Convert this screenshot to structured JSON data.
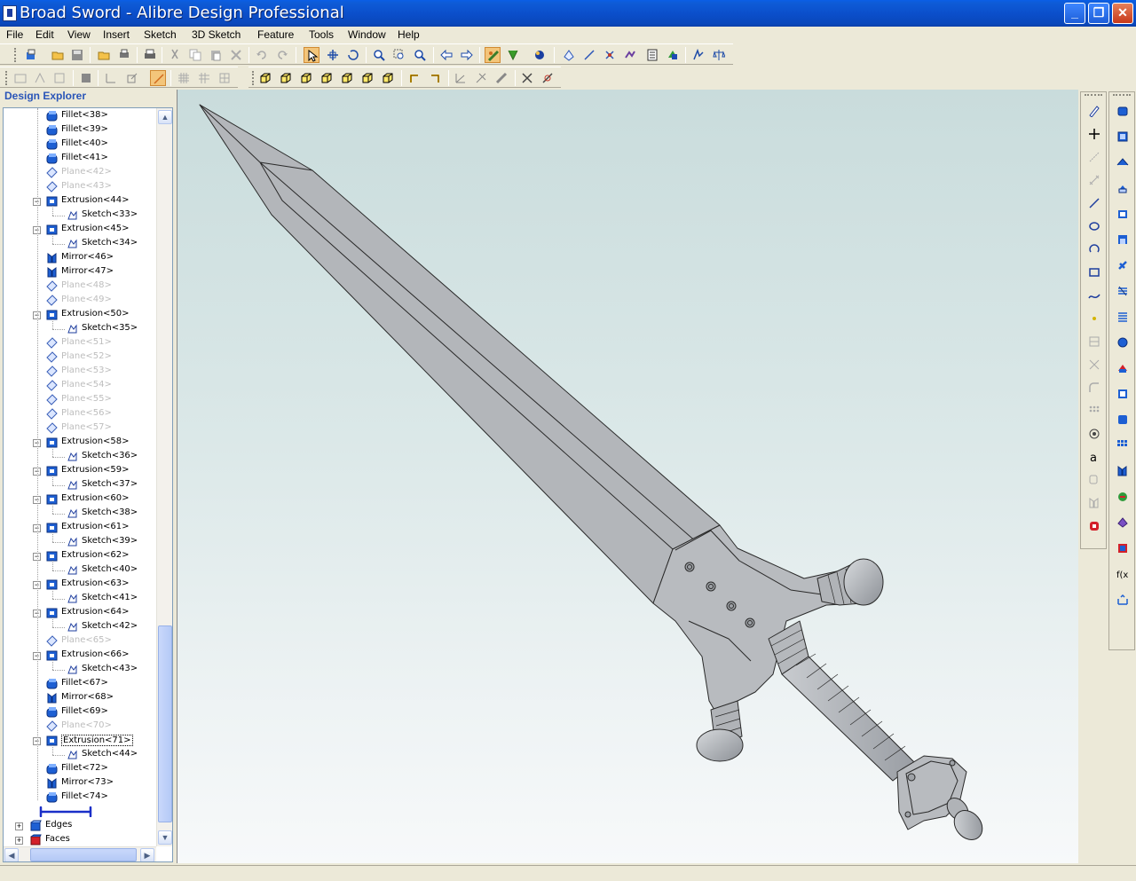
{
  "window": {
    "title": "Broad Sword - Alibre Design Professional",
    "minimize_glyph": "_",
    "maximize_glyph": "❐",
    "close_glyph": "✕"
  },
  "menu": [
    "File",
    "Edit",
    "View",
    "Insert",
    "Sketch",
    "3D Sketch",
    "Feature",
    "Tools",
    "Window",
    "Help"
  ],
  "explorer": {
    "title": "Design Explorer",
    "nodes": [
      {
        "label": "Fillet<38>",
        "icon": "fillet-icon"
      },
      {
        "label": "Fillet<39>",
        "icon": "fillet-icon"
      },
      {
        "label": "Fillet<40>",
        "icon": "fillet-icon"
      },
      {
        "label": "Fillet<41>",
        "icon": "fillet-icon"
      },
      {
        "label": "Plane<42>",
        "icon": "plane-icon"
      },
      {
        "label": "Plane<43>",
        "icon": "plane-icon"
      },
      {
        "label": "Extrusion<44>",
        "icon": "extrusion-icon"
      },
      {
        "label": "Sketch<33>",
        "icon": "sketch-icon"
      },
      {
        "label": "Extrusion<45>",
        "icon": "extrusion-icon"
      },
      {
        "label": "Sketch<34>",
        "icon": "sketch-icon"
      },
      {
        "label": "Mirror<46>",
        "icon": "mirror-icon"
      },
      {
        "label": "Mirror<47>",
        "icon": "mirror-icon"
      },
      {
        "label": "Plane<48>",
        "icon": "plane-icon"
      },
      {
        "label": "Plane<49>",
        "icon": "plane-icon"
      },
      {
        "label": "Extrusion<50>",
        "icon": "extrusion-icon"
      },
      {
        "label": "Sketch<35>",
        "icon": "sketch-icon"
      },
      {
        "label": "Plane<51>",
        "icon": "plane-icon"
      },
      {
        "label": "Plane<52>",
        "icon": "plane-icon"
      },
      {
        "label": "Plane<53>",
        "icon": "plane-icon"
      },
      {
        "label": "Plane<54>",
        "icon": "plane-icon"
      },
      {
        "label": "Plane<55>",
        "icon": "plane-icon"
      },
      {
        "label": "Plane<56>",
        "icon": "plane-icon"
      },
      {
        "label": "Plane<57>",
        "icon": "plane-icon"
      },
      {
        "label": "Extrusion<58>",
        "icon": "extrusion-icon"
      },
      {
        "label": "Sketch<36>",
        "icon": "sketch-icon"
      },
      {
        "label": "Extrusion<59>",
        "icon": "extrusion-icon"
      },
      {
        "label": "Sketch<37>",
        "icon": "sketch-icon"
      },
      {
        "label": "Extrusion<60>",
        "icon": "extrusion-icon"
      },
      {
        "label": "Sketch<38>",
        "icon": "sketch-icon"
      },
      {
        "label": "Extrusion<61>",
        "icon": "extrusion-icon"
      },
      {
        "label": "Sketch<39>",
        "icon": "sketch-icon"
      },
      {
        "label": "Extrusion<62>",
        "icon": "extrusion-icon"
      },
      {
        "label": "Sketch<40>",
        "icon": "sketch-icon"
      },
      {
        "label": "Extrusion<63>",
        "icon": "extrusion-icon"
      },
      {
        "label": "Sketch<41>",
        "icon": "sketch-icon"
      },
      {
        "label": "Extrusion<64>",
        "icon": "extrusion-icon"
      },
      {
        "label": "Sketch<42>",
        "icon": "sketch-icon"
      },
      {
        "label": "Plane<65>",
        "icon": "plane-icon"
      },
      {
        "label": "Extrusion<66>",
        "icon": "extrusion-icon"
      },
      {
        "label": "Sketch<43>",
        "icon": "sketch-icon"
      },
      {
        "label": "Fillet<67>",
        "icon": "fillet-icon"
      },
      {
        "label": "Mirror<68>",
        "icon": "mirror-icon"
      },
      {
        "label": "Fillet<69>",
        "icon": "fillet-icon"
      },
      {
        "label": "Plane<70>",
        "icon": "plane-icon"
      },
      {
        "label": "Extrusion<71>",
        "icon": "extrusion-icon"
      },
      {
        "label": "Sketch<44>",
        "icon": "sketch-icon"
      },
      {
        "label": "Fillet<72>",
        "icon": "fillet-icon"
      },
      {
        "label": "Mirror<73>",
        "icon": "mirror-icon"
      },
      {
        "label": "Fillet<74>",
        "icon": "fillet-icon"
      },
      {
        "label": "",
        "icon": "end-of-part-marker-icon"
      },
      {
        "label": "Edges",
        "icon": "edges-icon"
      },
      {
        "label": "Faces",
        "icon": "faces-icon"
      }
    ]
  },
  "colors": {
    "title_bar": "#0b4fcb",
    "part_fill": "#b3b6ba",
    "part_edge": "#2a2a2a",
    "explorer_title": "#2a55b8",
    "suppressed_text": "#bdbdbd",
    "selected_tool": "#f3c57a"
  },
  "palette_left": [
    "sketch-tool-icon",
    "point-icon",
    "construction-line-icon",
    "dimension-icon",
    "line-icon",
    "circle-icon",
    "arc-icon",
    "rectangle-icon",
    "spline-icon",
    "sketch-point-icon",
    "grid-icon",
    "trim-icon",
    "fillet-sketch-icon",
    "pattern-icon",
    "snap-icon",
    "text-icon",
    "copy-icon",
    "mirror-sketch-icon",
    "offset-icon"
  ],
  "palette_right": [
    "extrude-icon",
    "revolve-icon",
    "loft-icon",
    "sweep-icon",
    "shell-icon",
    "hole-icon",
    "thread-icon",
    "helix-icon",
    "spring-icon",
    "boss-icon",
    "cut-icon",
    "pocket-icon",
    "chamfer-icon",
    "pattern-feature-icon",
    "mirror-feature-icon",
    "draft-icon",
    "split-icon",
    "scale-icon",
    "equation-icon",
    "measure-icon"
  ]
}
